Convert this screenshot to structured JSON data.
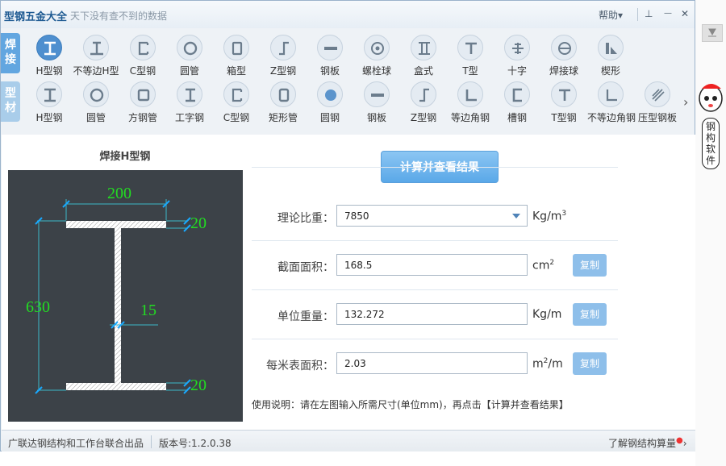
{
  "app": {
    "title": "型钢五金大全",
    "slogan": "天下没有查不到的数据",
    "help_label": "帮助",
    "help_caret": "▾",
    "pin_glyph": "⊥",
    "minimize_glyph": "—",
    "close_glyph": "✕"
  },
  "row1": {
    "tag": "焊接",
    "items": [
      {
        "label": "H型钢",
        "icon": "h-beam-icon",
        "active": true
      },
      {
        "label": "不等边H型",
        "icon": "unequal-h-icon"
      },
      {
        "label": "C型钢",
        "icon": "c-channel-icon"
      },
      {
        "label": "圆管",
        "icon": "round-tube-icon"
      },
      {
        "label": "箱型",
        "icon": "box-section-icon"
      },
      {
        "label": "Z型钢",
        "icon": "z-section-icon"
      },
      {
        "label": "钢板",
        "icon": "steel-plate-icon"
      },
      {
        "label": "螺栓球",
        "icon": "bolt-ball-icon"
      },
      {
        "label": "盒式",
        "icon": "box-type-icon"
      },
      {
        "label": "T型",
        "icon": "t-section-icon"
      },
      {
        "label": "十字",
        "icon": "cross-section-icon"
      },
      {
        "label": "焊接球",
        "icon": "welded-ball-icon"
      },
      {
        "label": "楔形",
        "icon": "wedge-icon"
      }
    ]
  },
  "row2": {
    "tag": "型材",
    "items": [
      {
        "label": "H型钢",
        "icon": "h-beam-icon"
      },
      {
        "label": "圆管",
        "icon": "round-tube-icon"
      },
      {
        "label": "方钢管",
        "icon": "square-tube-icon"
      },
      {
        "label": "工字钢",
        "icon": "i-beam-icon"
      },
      {
        "label": "C型钢",
        "icon": "c-channel-icon"
      },
      {
        "label": "矩形管",
        "icon": "rect-tube-icon"
      },
      {
        "label": "圆钢",
        "icon": "round-bar-icon"
      },
      {
        "label": "钢板",
        "icon": "steel-plate-icon"
      },
      {
        "label": "Z型钢",
        "icon": "z-section-icon"
      },
      {
        "label": "等边角钢",
        "icon": "equal-angle-icon"
      },
      {
        "label": "槽钢",
        "icon": "channel-icon"
      },
      {
        "label": "T型钢",
        "icon": "t-section-icon"
      },
      {
        "label": "不等边角钢",
        "icon": "unequal-angle-icon"
      },
      {
        "label": "压型钢板",
        "icon": "profiled-sheet-icon"
      }
    ],
    "more_glyph": "›"
  },
  "diagram": {
    "title": "焊接H型钢",
    "width": "200",
    "flange_top": "20",
    "web": "15",
    "height": "630",
    "flange_bottom": "20"
  },
  "calc_button": "计算并查看结果",
  "fields": {
    "density": {
      "label": "理论比重：",
      "value": "7850",
      "unit": "Kg/m",
      "unit_sup": "3"
    },
    "area": {
      "label": "截面面积：",
      "value": "168.5",
      "unit": "cm",
      "unit_sup": "2",
      "copy": "复制"
    },
    "weight": {
      "label": "单位重量：",
      "value": "132.272",
      "unit": "Kg/m",
      "copy": "复制"
    },
    "surface": {
      "label": "每米表面积：",
      "value": "2.03",
      "unit_a": "m",
      "unit_sup": "2",
      "unit_b": "/m",
      "copy": "复制"
    }
  },
  "usage": "使用说明：请在左图输入所需尺寸(单位mm)，再点击【计算并查看结果】",
  "status": {
    "left": "广联达钢结构和工作台联合出品",
    "version": "版本号:1.2.0.38",
    "right": "了解钢结构算量",
    "right_arrow": "›"
  },
  "side_widget": {
    "text": "钢构软件"
  },
  "colors": {
    "accent": "#5aa8e8",
    "dimension": "#22dd22",
    "diagram_bg": "#3c4248"
  }
}
